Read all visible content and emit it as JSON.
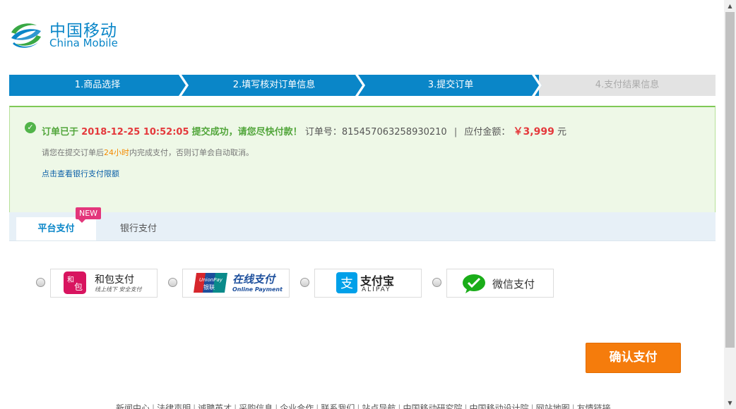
{
  "brand": {
    "name_cn": "中国移动",
    "name_en": "China Mobile",
    "color": "#0a86c8"
  },
  "steps": [
    {
      "label": "1.商品选择",
      "state": "done"
    },
    {
      "label": "2.填写核对订单信息",
      "state": "done"
    },
    {
      "label": "3.提交订单",
      "state": "current"
    },
    {
      "label": "4.支付结果信息",
      "state": "pending"
    }
  ],
  "notice": {
    "prefix": "订单已于",
    "datetime": "2018-12-25 10:52:05",
    "success_text": "提交成功，请您尽快付款！",
    "order_label": "订单号：",
    "order_no": "815457063258930210",
    "separator": "|",
    "amount_label": "应付金额：",
    "amount": "￥3,999",
    "amount_unit": "元",
    "hint_before": "请您在提交订单后",
    "hint_time": "24小时",
    "hint_after": "内完成支付，否则订单会自动取消。",
    "bank_limit_link": "点击查看银行支付限额"
  },
  "tabs": [
    {
      "label": "平台支付",
      "active": true,
      "badge": "NEW"
    },
    {
      "label": "银行支付",
      "active": false
    }
  ],
  "payment_methods": [
    {
      "name": "和包支付",
      "sub": "线上线下 安全支付",
      "logo_text": "和包",
      "icon": "hebao-icon"
    },
    {
      "name": "在线支付",
      "sub": "Online Payment",
      "logo_text": "UnionPay 银联",
      "icon": "unionpay-icon"
    },
    {
      "name": "支付宝",
      "sub": "ALIPAY",
      "icon": "alipay-icon"
    },
    {
      "name": "微信支付",
      "icon": "wechat-pay-icon"
    }
  ],
  "confirm_button": "确认支付",
  "footer_links": [
    "新闻中心",
    "法律声明",
    "诚聘英才",
    "采购信息",
    "企业合作",
    "联系我们",
    "站点导航",
    "中国移动研究院",
    "中国移动设计院",
    "网站地图",
    "友情链接"
  ],
  "colors": {
    "step_active": "#0a86c8",
    "notice_bg": "#eef8e7",
    "accent_red": "#e4393c",
    "confirm_orange": "#f57c0c",
    "badge_pink": "#e3367b"
  }
}
